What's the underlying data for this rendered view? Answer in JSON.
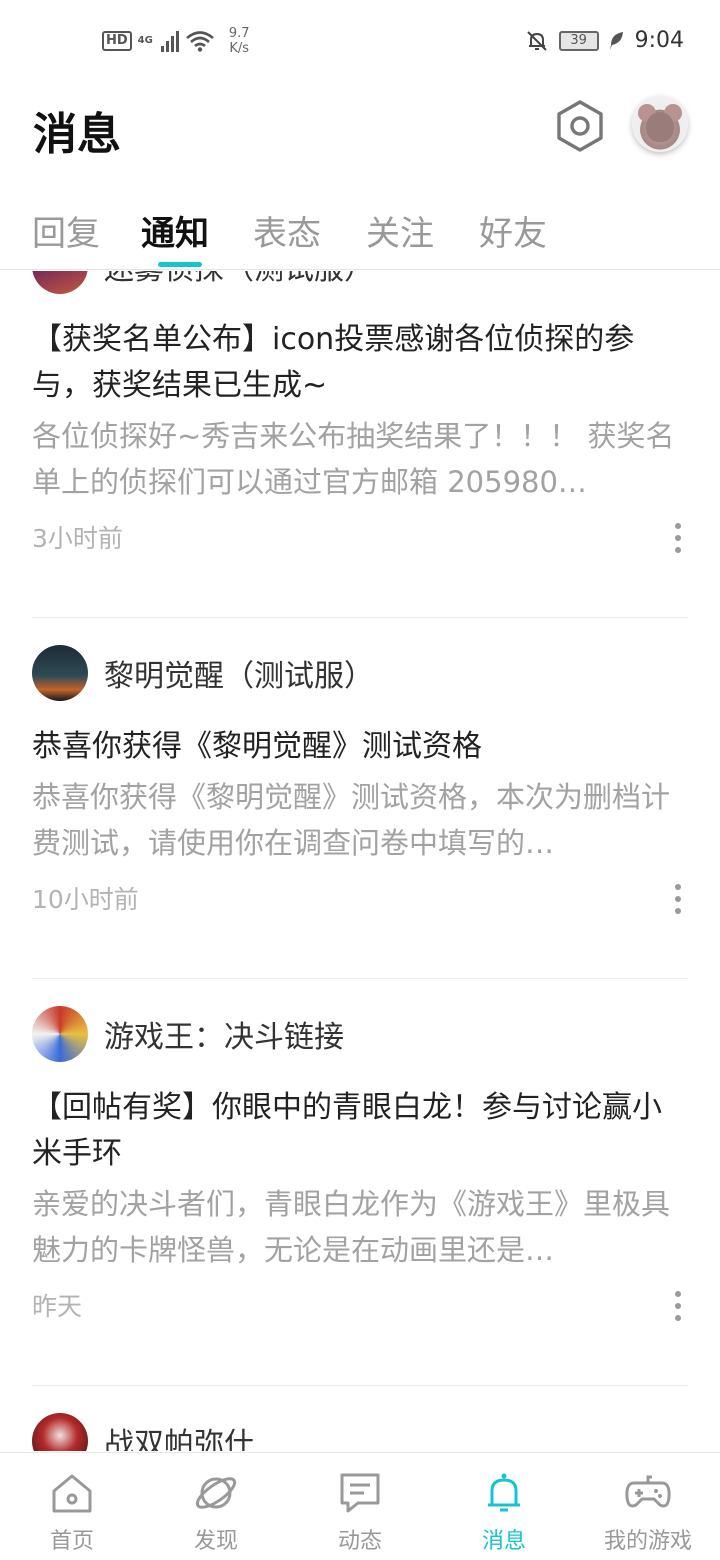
{
  "status_bar": {
    "hd": "HD",
    "net": "4G",
    "speed_value": "9.7",
    "speed_unit": "K/s",
    "battery": "39",
    "time": "9:04"
  },
  "header": {
    "title": "消息"
  },
  "tabs": [
    {
      "label": "回复"
    },
    {
      "label": "通知"
    },
    {
      "label": "表态"
    },
    {
      "label": "关注"
    },
    {
      "label": "好友"
    }
  ],
  "active_tab": "通知",
  "accent_color": "#15c5ce",
  "notifications": [
    {
      "game": "迷雾侦探（测试服）",
      "title": "【获奖名单公布】icon投票感谢各位侦探的参与，获奖结果已生成~",
      "body": "各位侦探好~秀吉来公布抽奖结果了！！！ 获奖名单上的侦探们可以通过官方邮箱 205980…",
      "time": "3小时前"
    },
    {
      "game": "黎明觉醒（测试服）",
      "title": "恭喜你获得《黎明觉醒》测试资格",
      "body": "恭喜你获得《黎明觉醒》测试资格，本次为删档计费测试，请使用你在调查问卷中填写的…",
      "time": "10小时前"
    },
    {
      "game": "游戏王：决斗链接",
      "title": "【回帖有奖】你眼中的青眼白龙！参与讨论赢小米手环",
      "body": "亲爱的决斗者们，青眼白龙作为《游戏王》里极具魅力的卡牌怪兽，无论是在动画里还是…",
      "time": "昨天"
    },
    {
      "game": "战双帕弥什"
    }
  ],
  "bottom_nav": [
    {
      "label": "首页",
      "icon": "home-icon"
    },
    {
      "label": "发现",
      "icon": "planet-icon"
    },
    {
      "label": "动态",
      "icon": "chat-icon"
    },
    {
      "label": "消息",
      "icon": "bell-icon"
    },
    {
      "label": "我的游戏",
      "icon": "gamepad-icon"
    }
  ]
}
